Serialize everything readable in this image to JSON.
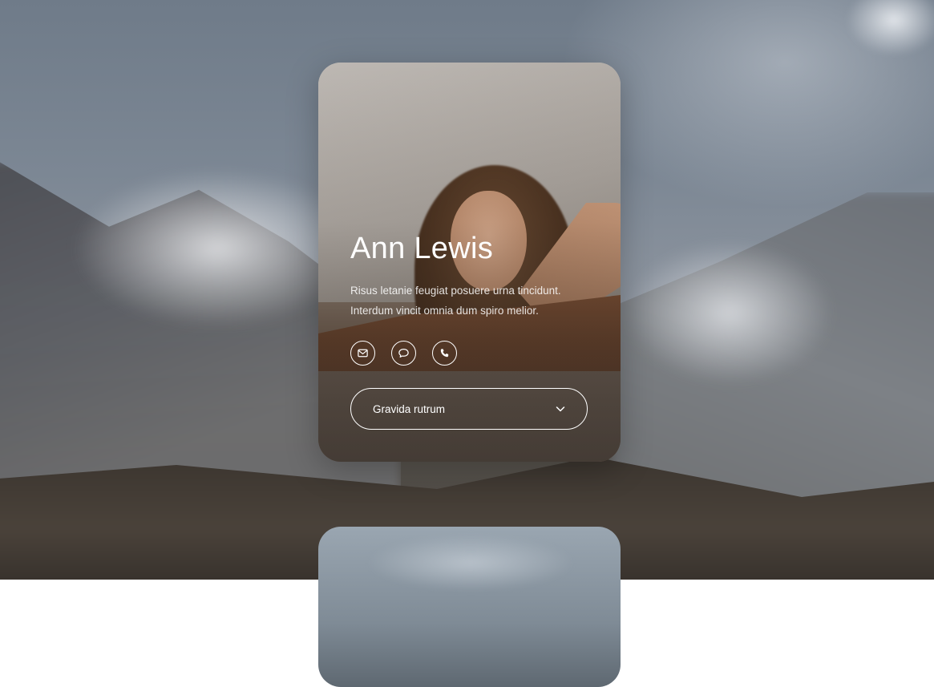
{
  "profile": {
    "name": "Ann Lewis",
    "description": "Risus letanie feugiat posuere urna tincidunt. Interdum vincit omnia dum spiro melior.",
    "contact_icons": [
      "mail-icon",
      "chat-icon",
      "phone-icon"
    ],
    "dropdown_label": "Gravida rutrum",
    "dropdown_icon": "chevron-down-icon"
  },
  "colors": {
    "text": "#ffffff",
    "outline": "#ffffff"
  }
}
